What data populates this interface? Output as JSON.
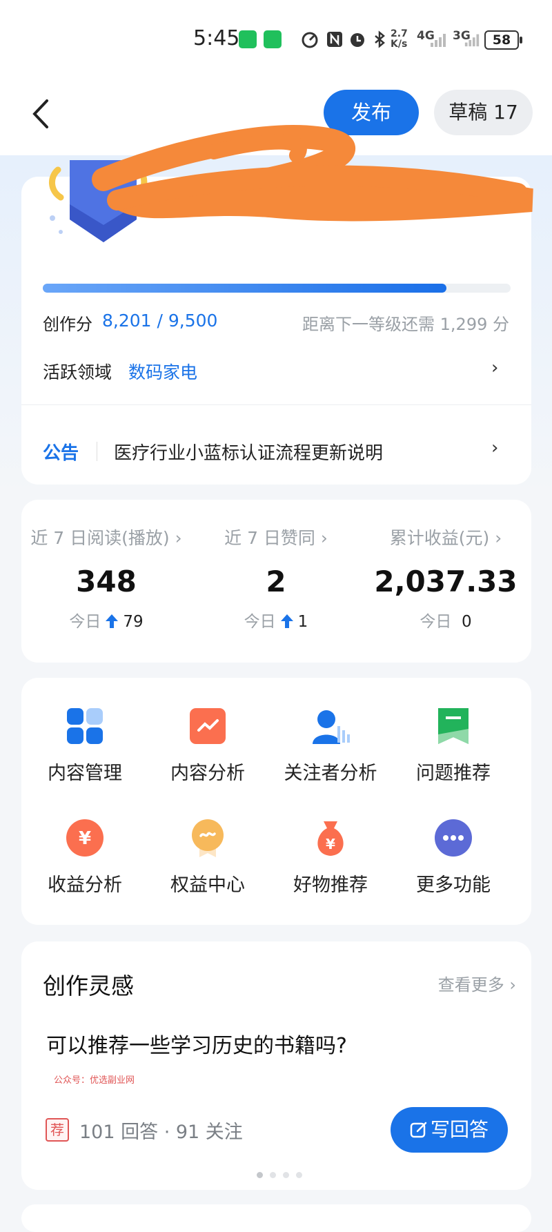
{
  "status_bar": {
    "time": "5:45",
    "network_speed": "2.7 K/s",
    "signal_1": "4G",
    "signal_2": "3G",
    "battery": "58"
  },
  "header": {
    "publish_label": "发布",
    "draft_label": "草稿 17"
  },
  "level_card": {
    "progress_fraction": 0.863,
    "score_label": "创作分",
    "score_value": "8,201 / 9,500",
    "next_level_text": "距离下一等级还需 1,299 分",
    "active_field_label": "活跃领域",
    "active_field_value": "数码家电",
    "notice_tag": "公告",
    "notice_text": "医疗行业小蓝标认证流程更新说明"
  },
  "stats": [
    {
      "label": "近 7 日阅读(播放) ›",
      "value": "348",
      "today_label": "今日",
      "today_value": "79",
      "arrow": true
    },
    {
      "label": "近 7 日赞同 ›",
      "value": "2",
      "today_label": "今日",
      "today_value": "1",
      "arrow": true
    },
    {
      "label": "累计收益(元) ›",
      "value": "2,037.33",
      "today_label": "今日",
      "today_value": "0",
      "arrow": false
    }
  ],
  "tools": [
    {
      "label": "内容管理",
      "icon": "grid-icon"
    },
    {
      "label": "内容分析",
      "icon": "trend-chart-icon"
    },
    {
      "label": "关注者分析",
      "icon": "follower-stats-icon"
    },
    {
      "label": "问题推荐",
      "icon": "bookmark-icon"
    },
    {
      "label": "收益分析",
      "icon": "yuan-coin-icon"
    },
    {
      "label": "权益中心",
      "icon": "medal-icon"
    },
    {
      "label": "好物推荐",
      "icon": "money-bag-icon"
    },
    {
      "label": "更多功能",
      "icon": "more-dots-icon"
    }
  ],
  "inspiration": {
    "title": "创作灵感",
    "more_label": "查看更多 ›",
    "question": "可以推荐一些学习历史的书籍吗?",
    "watermark": "公众号：优选副业网",
    "rec_tag": "荐",
    "meta": "101 回答 · 91 关注",
    "answer_label": "写回答"
  },
  "colors": {
    "accent": "#1a73e8",
    "redaction": "#f5893a"
  }
}
